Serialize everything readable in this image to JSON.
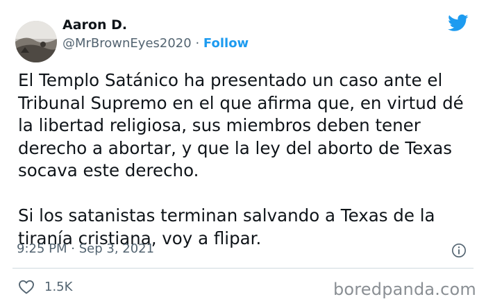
{
  "author": {
    "name": "Aaron D.",
    "handle": "@MrBrownEyes2020",
    "separator": "·",
    "follow_label": "Follow"
  },
  "tweet": {
    "paragraphs": [
      "El Templo Satánico ha presentado un caso ante el\nTribunal Supremo en el que afirma que, en virtud dé\nla libertad religiosa, sus miembros deben tener\nderecho a abortar, y que la ley del aborto de Texas\nsocava este derecho.",
      "Si los satanistas terminan salvando a Texas de la\ntiranía cristiana, voy a flipar."
    ],
    "time": "9:25 PM",
    "date_separator": "·",
    "date": "Sep 3, 2021"
  },
  "engagement": {
    "likes": "1.5K"
  },
  "watermark": "boredpanda.com",
  "colors": {
    "accent": "#1d9bf0",
    "text": "#0f1419",
    "muted": "#536471"
  },
  "icons": {
    "brand": "twitter-bird-icon",
    "info": "info-icon",
    "like": "heart-icon"
  }
}
